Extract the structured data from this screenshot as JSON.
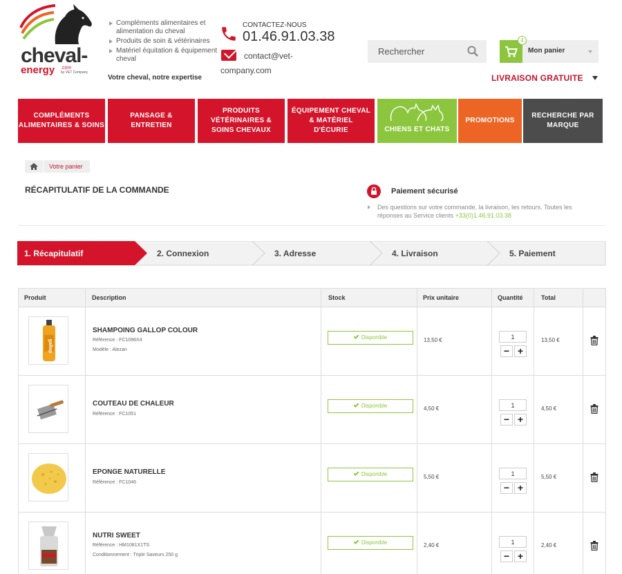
{
  "brand": {
    "name_line1": "cheval-",
    "name_line2": "energy",
    "com": ".com",
    "by": "by VET Company"
  },
  "header": {
    "usp": [
      "Compléments alimentaires et alimentation du cheval",
      "Produits de soin & vétérinaires",
      "Matériel équitation & équipement cheval"
    ],
    "tagline": "Votre cheval, notre expertise",
    "contact_label": "CONTACTEZ-NOUS",
    "phone": "01.46.91.03.38",
    "email": "contact@vet-company.com",
    "search_placeholder": "Rechercher",
    "cart_label": "Mon panier",
    "cart_count": "4",
    "free_shipping": "LIVRAISON GRATUITE"
  },
  "nav": [
    {
      "label": "COMPLÉMENTS ALIMENTAIRES & SOINS"
    },
    {
      "label": "PANSAGE & ENTRETIEN"
    },
    {
      "label": "PRODUITS VÉTÉRINAIRES & SOINS CHEVAUX"
    },
    {
      "label": "ÉQUIPEMENT CHEVAL & MATÉRIEL D'ÉCURIE"
    },
    {
      "label": "CHIENS ET CHATS"
    },
    {
      "label": "PROMOTIONS"
    },
    {
      "label": "RECHERCHE PAR MARQUE"
    }
  ],
  "breadcrumb": {
    "current": "Votre panier"
  },
  "page": {
    "title": "RÉCAPITULATIF DE LA COMMANDE",
    "secure_title": "Paiement sécurisé",
    "help_text": "Des questions sur votre commande, la livraison, les retours. Toutes les réponses au Service clients ",
    "help_phone": "+33(0)1.46.91.03.38"
  },
  "steps": [
    "1. Récapitulatif",
    "2. Connexion",
    "3. Adresse",
    "4. Livraison",
    "5. Paiement"
  ],
  "table": {
    "headers": [
      "Produit",
      "Description",
      "Stock",
      "Prix unitaire",
      "Quantité",
      "Total"
    ],
    "rows": [
      {
        "name": "SHAMPOING GALLOP COLOUR",
        "meta": [
          "Référence : FC1096X4",
          "Modèle : Alezan"
        ],
        "stock": "Disponible",
        "price": "13,50 €",
        "qty": "1",
        "total": "13,50 €"
      },
      {
        "name": "COUTEAU DE CHALEUR",
        "meta": [
          "Référence : FC1051"
        ],
        "stock": "Disponible",
        "price": "4,50 €",
        "qty": "1",
        "total": "4,50 €"
      },
      {
        "name": "EPONGE NATURELLE",
        "meta": [
          "Référence : FC1046"
        ],
        "stock": "Disponible",
        "price": "5,50 €",
        "qty": "1",
        "total": "5,50 €"
      },
      {
        "name": "NUTRI SWEET",
        "meta": [
          "Référence : HM1081X1TS",
          "Conditionnement : Triple Saveurs 250 g"
        ],
        "stock": "Disponible",
        "price": "2,40 €",
        "qty": "1",
        "total": "2,40 €"
      }
    ]
  },
  "colors": {
    "brand_red": "#d3142a",
    "green": "#8cc63e",
    "orange": "#ed6524",
    "dark": "#4c4c4c"
  }
}
